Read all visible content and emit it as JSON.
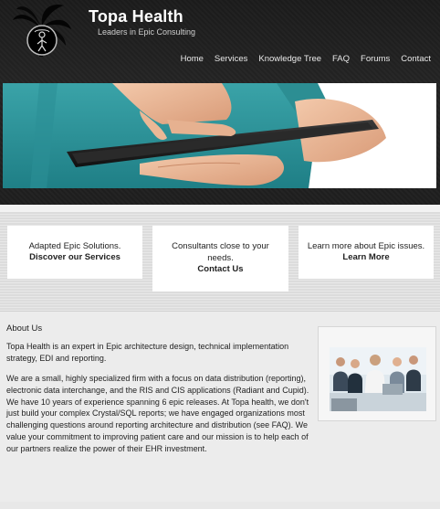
{
  "brand": {
    "title": "Topa Health",
    "tagline": "Leaders in Epic Consulting"
  },
  "nav": {
    "items": [
      "Home",
      "Services",
      "Knowledge Tree",
      "FAQ",
      "Forums",
      "Contact"
    ]
  },
  "features": [
    {
      "text": "Adapted Epic Solutions.",
      "link": "Discover our Services"
    },
    {
      "text": "Consultants close to your needs.",
      "link": "Contact Us"
    },
    {
      "text": "Learn more about Epic issues.",
      "link": "Learn More"
    }
  ],
  "about": {
    "heading": "About Us",
    "p1": "Topa Health is an expert in Epic architecture design, technical implementation strategy, EDI and reporting.",
    "p2": "We are a small, highly specialized firm with a focus on data distribution (reporting), electronic data interchange, and the RIS and CIS applications (Radiant and Cupid). We have 10 years of experience spanning 6 epic releases. At Topa health, we don't just build your complex Crystal/SQL reports; we have engaged organizations most challenging questions around reporting architecture and distribution (see FAQ). We value your commitment to improving patient care and our mission is to help each of our partners realize the power of their EHR investment."
  },
  "colors": {
    "header_bg": "#1e1e1e",
    "nav_text": "#e8e8e8",
    "feature_bg": "#dcdcdc",
    "about_bg": "#ececec"
  }
}
